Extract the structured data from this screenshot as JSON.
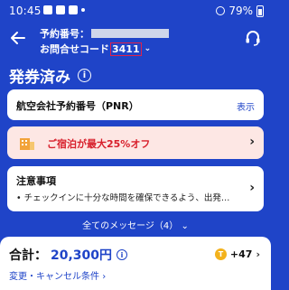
{
  "status_bar": {
    "time": "10:45",
    "battery": "79%"
  },
  "header": {
    "booking_label": "予約番号：",
    "inquiry_label": "お問合せコード",
    "inquiry_code": "3411",
    "title": "発券済み",
    "info_glyph": "i"
  },
  "pnr_card": {
    "label": "航空会社予約番号（PNR）",
    "show": "表示"
  },
  "promo_card": {
    "text": "ご宿泊が最大25%オフ"
  },
  "notice_card": {
    "title": "注意事項",
    "text": "• チェックインに十分な時間を確保できるよう、出発…"
  },
  "messages": {
    "label": "全てのメッセージ（4）"
  },
  "bottom": {
    "total_label": "合計：",
    "total_amount": "20,300円",
    "points": "+47",
    "coin_glyph": "T",
    "change_link": "変更・キャンセル条件"
  },
  "colors": {
    "brand_blue": "#1f44c8",
    "promo_bg": "#fde7e4",
    "promo_red": "#d8202c",
    "code_highlight": "#e0224a"
  },
  "icons": [
    "back-arrow-icon",
    "headset-icon",
    "info-icon",
    "hotel-icon",
    "chevron-right-icon",
    "coin-icon"
  ]
}
